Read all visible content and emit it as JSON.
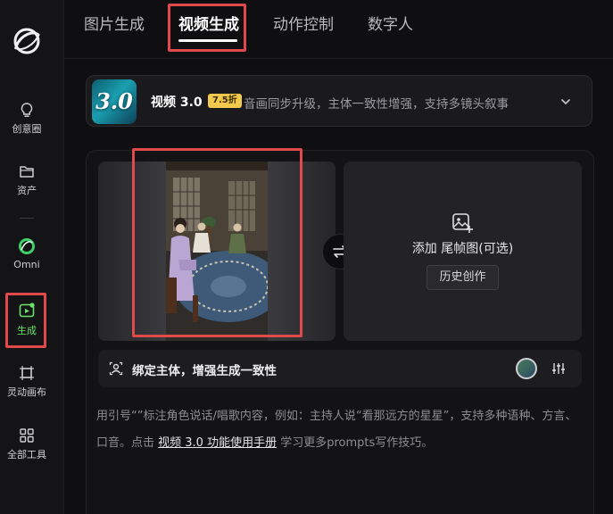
{
  "sidebar": {
    "items": [
      {
        "label": "创意圈",
        "icon": "lightbulb-icon"
      },
      {
        "label": "资产",
        "icon": "folder-icon"
      },
      {
        "label": "Omni",
        "icon": "omni-ring-icon"
      },
      {
        "label": "生成",
        "icon": "generate-video-icon",
        "active": true
      },
      {
        "label": "灵动画布",
        "icon": "canvas-frame-icon"
      },
      {
        "label": "全部工具",
        "icon": "grid-tools-icon"
      }
    ]
  },
  "tabs": [
    {
      "label": "图片生成"
    },
    {
      "label": "视频生成",
      "active": true
    },
    {
      "label": "动作控制"
    },
    {
      "label": "数字人"
    }
  ],
  "model": {
    "thumb_text": "3.0",
    "name": "视频 3.0",
    "badge": "7.5折",
    "description": "音画同步升级，主体一致性增强，支持多镜头叙事"
  },
  "end_frame": {
    "label": "添加 尾帧图(可选)",
    "history_button": "历史创作"
  },
  "bind_subject": {
    "label": "绑定主体，增强生成一致性"
  },
  "hint": {
    "text_before": "用引号“”标注角色说话/唱歌内容，例如：主持人说“看那远方的星星”，支持多种语种、方言、口音。点击 ",
    "link": "视频 3.0 功能使用手册",
    "text_after": " 学习更多prompts写作技巧。"
  },
  "colors": {
    "accent_green": "#6be36b",
    "highlight_red": "#e04a4a",
    "badge_yellow": "#f2c94c"
  }
}
